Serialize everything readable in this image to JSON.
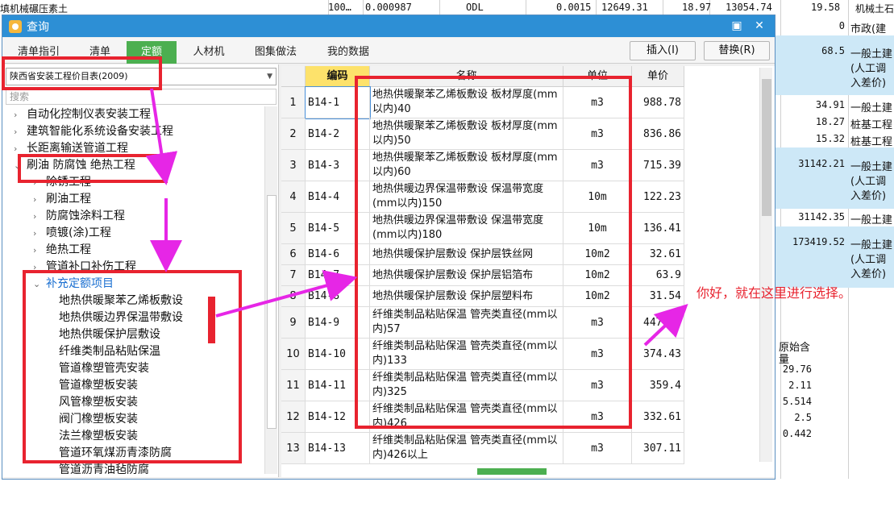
{
  "background": {
    "top_row": [
      "填机械碾压素土",
      "100…",
      "0.000987",
      "ODL",
      "0.0015",
      "12649.31",
      "18.97",
      "13054.74",
      "19.58",
      "机械土石"
    ],
    "right_values": [
      {
        "num": "0",
        "text": "市政(建"
      },
      {
        "num": "68.5",
        "text": "一般土建"
      },
      {
        "num": "",
        "text": "(人工调"
      },
      {
        "num": "",
        "text": "入差价)"
      },
      {
        "num": "34.91",
        "text": "一般土建"
      },
      {
        "num": "18.27",
        "text": "桩基工程"
      },
      {
        "num": "15.32",
        "text": "桩基工程"
      },
      {
        "num": "31142.21",
        "text": "一般土建"
      },
      {
        "num": "",
        "text": "(人工调"
      },
      {
        "num": "",
        "text": "入差价)"
      },
      {
        "num": "31142.35",
        "text": "一般土建"
      },
      {
        "num": "173419.52",
        "text": "一般土建"
      },
      {
        "num": "",
        "text": "(人工调"
      },
      {
        "num": "",
        "text": "入差价)"
      }
    ],
    "bottom_header": [
      "原始含",
      "量"
    ],
    "bottom_values": [
      "29.76",
      "2.11",
      "5.514",
      "2.5",
      "0.442"
    ]
  },
  "dialog": {
    "title": "查询",
    "tabs": [
      "清单指引",
      "清单",
      "定额",
      "人材机",
      "图集做法",
      "我的数据"
    ],
    "active_tab": "定额",
    "insert_label": "插入(I)",
    "replace_label": "替换(R)"
  },
  "left": {
    "library": "陕西省安装工程价目表(2009)",
    "search_placeholder": "搜索",
    "tree": [
      {
        "label": "自动化控制仪表安装工程",
        "level": 1,
        "arrow": ">"
      },
      {
        "label": "建筑智能化系统设备安装工程",
        "level": 1,
        "arrow": ">"
      },
      {
        "label": "长距离输送管道工程",
        "level": 1,
        "arrow": ">"
      },
      {
        "label": "刷油 防腐蚀 绝热工程",
        "level": 1,
        "arrow": "v"
      },
      {
        "label": "除锈工程",
        "level": 2,
        "arrow": ">"
      },
      {
        "label": "刷油工程",
        "level": 2,
        "arrow": ">"
      },
      {
        "label": "防腐蚀涂料工程",
        "level": 2,
        "arrow": ">"
      },
      {
        "label": "喷镀(涂)工程",
        "level": 2,
        "arrow": ">"
      },
      {
        "label": "绝热工程",
        "level": 2,
        "arrow": ">"
      },
      {
        "label": "管道补口补伤工程",
        "level": 2,
        "arrow": ">"
      },
      {
        "label": "补充定额项目",
        "level": 2,
        "arrow": "v",
        "blue": true
      },
      {
        "label": "地热供暖聚苯乙烯板敷设",
        "level": 3
      },
      {
        "label": "地热供暖边界保温带敷设",
        "level": 3
      },
      {
        "label": "地热供暖保护层敷设",
        "level": 3
      },
      {
        "label": "纤维类制品粘贴保温",
        "level": 3
      },
      {
        "label": "管道橡塑管壳安装",
        "level": 3
      },
      {
        "label": "管道橡塑板安装",
        "level": 3
      },
      {
        "label": "风管橡塑板安装",
        "level": 3
      },
      {
        "label": "阀门橡塑板安装",
        "level": 3
      },
      {
        "label": "法兰橡塑板安装",
        "level": 3
      },
      {
        "label": "管道环氧煤沥青漆防腐",
        "level": 3
      },
      {
        "label": "管道沥青油毡防腐",
        "level": 3
      }
    ]
  },
  "grid": {
    "headers": [
      "编码",
      "名称",
      "单位",
      "单价"
    ],
    "rows": [
      {
        "num": "1",
        "code": "B14-1",
        "name": "地热供暖聚苯乙烯板敷设 板材厚度(mm以内)40",
        "unit": "m3",
        "price": "988.78"
      },
      {
        "num": "2",
        "code": "B14-2",
        "name": "地热供暖聚苯乙烯板敷设 板材厚度(mm以内)50",
        "unit": "m3",
        "price": "836.86"
      },
      {
        "num": "3",
        "code": "B14-3",
        "name": "地热供暖聚苯乙烯板敷设 板材厚度(mm以内)60",
        "unit": "m3",
        "price": "715.39"
      },
      {
        "num": "4",
        "code": "B14-4",
        "name": "地热供暖边界保温带敷设 保温带宽度(mm以内)150",
        "unit": "10m",
        "price": "122.23"
      },
      {
        "num": "5",
        "code": "B14-5",
        "name": "地热供暖边界保温带敷设 保温带宽度(mm以内)180",
        "unit": "10m",
        "price": "136.41"
      },
      {
        "num": "6",
        "code": "B14-6",
        "name": "地热供暖保护层敷设 保护层铁丝网",
        "unit": "10m2",
        "price": "32.61"
      },
      {
        "num": "7",
        "code": "B14-7",
        "name": "地热供暖保护层敷设 保护层铝箔布",
        "unit": "10m2",
        "price": "63.9"
      },
      {
        "num": "8",
        "code": "B14-8",
        "name": "地热供暖保护层敷设 保护层塑料布",
        "unit": "10m2",
        "price": "31.54"
      },
      {
        "num": "9",
        "code": "B14-9",
        "name": "纤维类制品粘贴保温 管壳类直径(mm以内)57",
        "unit": "m3",
        "price": "447.18"
      },
      {
        "num": "10",
        "code": "B14-10",
        "name": "纤维类制品粘贴保温 管壳类直径(mm以内)133",
        "unit": "m3",
        "price": "374.43"
      },
      {
        "num": "11",
        "code": "B14-11",
        "name": "纤维类制品粘贴保温 管壳类直径(mm以内)325",
        "unit": "m3",
        "price": "359.4"
      },
      {
        "num": "12",
        "code": "B14-12",
        "name": "纤维类制品粘贴保温 管壳类直径(mm以内)426",
        "unit": "m3",
        "price": "332.61"
      },
      {
        "num": "13",
        "code": "B14-13",
        "name": "纤维类制品粘贴保温 管壳类直径(mm以内)426以上",
        "unit": "m3",
        "price": "307.11"
      }
    ]
  },
  "annotation": "你好，就在这里进行选择。",
  "colors": {
    "accent": "#2d8fd5",
    "active_tab": "#4caf50",
    "mark": "#e8232f",
    "arrow": "#e626e6"
  }
}
